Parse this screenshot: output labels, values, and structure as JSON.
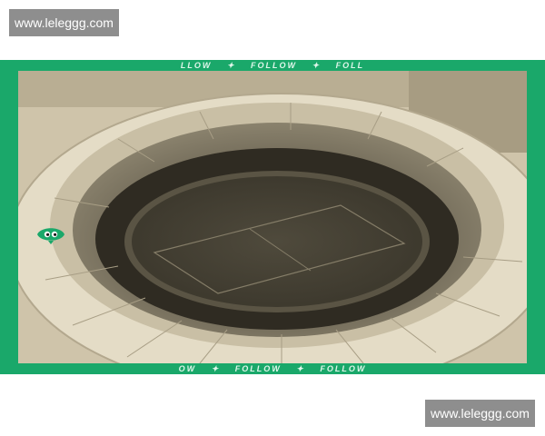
{
  "watermarks": {
    "top": "www.leleggg.com",
    "bottom": "www.leleggg.com"
  },
  "frame": {
    "accent_color": "#1aa86a",
    "ticker_top": [
      "LLOW",
      "✦",
      "FOLLOW",
      "✦",
      "FOLL"
    ],
    "ticker_bottom": [
      "OW",
      "✦",
      "FOLLOW",
      "✦",
      "FOLLOW"
    ]
  },
  "photo": {
    "subject": "aerial-stadium",
    "tone": "sepia"
  },
  "icons": {
    "badge": "eyes-badge-icon"
  }
}
